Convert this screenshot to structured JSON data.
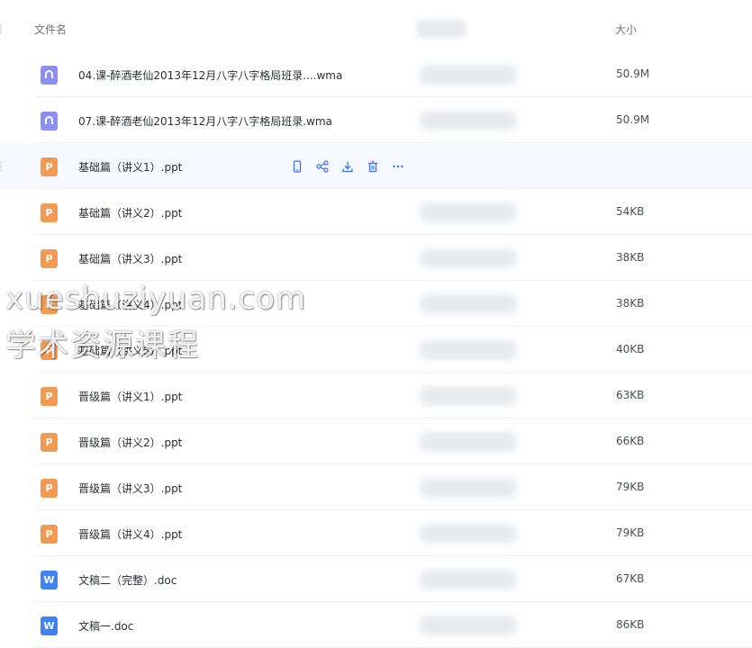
{
  "header": {
    "col_name": "文件名",
    "col_size": "大小"
  },
  "files": [
    {
      "name": "04.课-醉酒老仙2013年12月八字八字格局班录....wma",
      "type": "audio",
      "size": "50.9M"
    },
    {
      "name": "07.课-醉酒老仙2013年12月八字八字格局班录.wma",
      "type": "audio",
      "size": "50.9M"
    },
    {
      "name": "基础篇（讲义1）.ppt",
      "type": "ppt",
      "size": "",
      "hovered": true
    },
    {
      "name": "基础篇（讲义2）.ppt",
      "type": "ppt",
      "size": "54KB"
    },
    {
      "name": "基础篇（讲义3）.ppt",
      "type": "ppt",
      "size": "38KB"
    },
    {
      "name": "基础篇（讲义4）.ppt",
      "type": "ppt",
      "size": "38KB"
    },
    {
      "name": "基础篇（讲义5）.ppt",
      "type": "ppt",
      "size": "40KB"
    },
    {
      "name": "晋级篇（讲义1）.ppt",
      "type": "ppt",
      "size": "63KB"
    },
    {
      "name": "晋级篇（讲义2）.ppt",
      "type": "ppt",
      "size": "66KB"
    },
    {
      "name": "晋级篇（讲义3）.ppt",
      "type": "ppt",
      "size": "79KB"
    },
    {
      "name": "晋级篇（讲义4）.ppt",
      "type": "ppt",
      "size": "79KB"
    },
    {
      "name": "文稿二（完整）.doc",
      "type": "doc",
      "size": "67KB"
    },
    {
      "name": "文稿一.doc",
      "type": "doc",
      "size": "86KB"
    }
  ],
  "icon_letters": {
    "ppt": "P",
    "doc": "W",
    "audio": ""
  },
  "hover_actions": [
    "phone-icon",
    "share-icon",
    "download-icon",
    "delete-icon",
    "more-icon"
  ],
  "colors": {
    "accent": "#3370ff",
    "ppt": "#f39a52",
    "doc": "#3d83f6",
    "audio": "#8b8ff5"
  },
  "watermark": {
    "line1": "xueshuziyuan.com",
    "line2": "学术资源课程"
  }
}
